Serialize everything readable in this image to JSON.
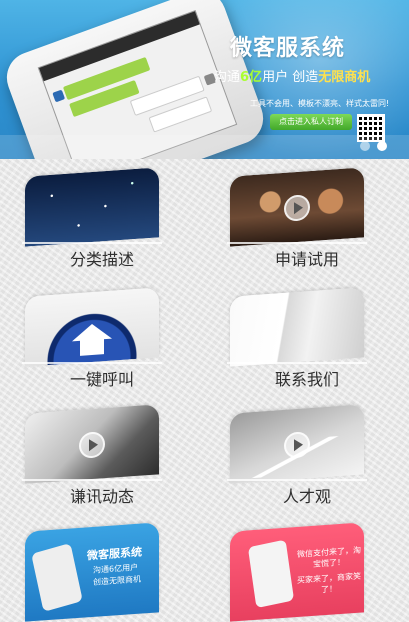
{
  "banner": {
    "title": "微客服系统",
    "subtitle_prefix": "沟通",
    "subtitle_highlight1": "6亿",
    "subtitle_mid": "用户  创造",
    "subtitle_highlight2": "无限商机",
    "note": "工具不会用、模板不漂亮、样式太雷同!",
    "cta": "点击进入私人订制",
    "accent_green": "#a9ff2f",
    "accent_yellow": "#ffe14d"
  },
  "tiles": [
    {
      "label": "分类描述",
      "icon": "starry-sky-thumb"
    },
    {
      "label": "申请试用",
      "icon": "meeting-thumb"
    },
    {
      "label": "一键呼叫",
      "icon": "home-icon"
    },
    {
      "label": "联系我们",
      "icon": "paper-thumb"
    },
    {
      "label": "谦讯动态",
      "icon": "news-thumb"
    },
    {
      "label": "人才观",
      "icon": "talent-thumb"
    }
  ],
  "bottom_tiles": [
    {
      "title": "微客服系统",
      "line1": "沟通6亿用户",
      "line2": "创造无限商机"
    },
    {
      "title": "微信支付来了，淘宝慌了！",
      "line1": "买家来了，商家笑了！"
    }
  ]
}
